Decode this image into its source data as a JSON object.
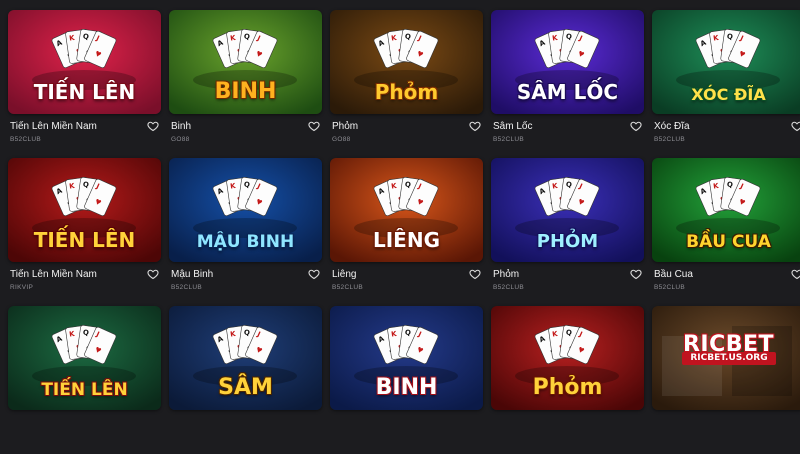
{
  "games": [
    {
      "title_art": "TIẾN LÊN",
      "name": "Tiến Lên Miền Nam",
      "provider": "B52CLUB",
      "bg1": "#e0224a",
      "bg2": "#7a0f2a",
      "title_color": "#ffffff",
      "stroke": "#7a0b18",
      "title_size": 20
    },
    {
      "title_art": "BINH",
      "name": "Binh",
      "provider": "GO88",
      "bg1": "#6aa32c",
      "bg2": "#1e4d12",
      "title_color": "#ffb21f",
      "stroke": "#6b2a00",
      "title_size": 22
    },
    {
      "title_art": "Phỏm",
      "name": "Phỏm",
      "provider": "GO88",
      "bg1": "#7b4a14",
      "bg2": "#2b1a08",
      "title_color": "#ffca2e",
      "stroke": "#7a2a00",
      "title_size": 20
    },
    {
      "title_art": "SÂM LỐC",
      "name": "Sâm Lốc",
      "provider": "B52CLUB",
      "bg1": "#5b2bd6",
      "bg2": "#1f0d66",
      "title_color": "#ffffff",
      "stroke": "#1b0b55",
      "title_size": 20
    },
    {
      "title_art": "XÓC ĐĨA",
      "name": "Xóc Đĩa",
      "provider": "B52CLUB",
      "bg1": "#1e8e58",
      "bg2": "#0a3d24",
      "title_color": "#ffe14a",
      "stroke": "#0b4d24",
      "title_size": 16
    },
    {
      "title_art": "TIẾN LÊN",
      "name": "Tiến Lên Miền Nam",
      "provider": "RIKVIP",
      "bg1": "#b51a1a",
      "bg2": "#4d0606",
      "title_color": "#ffd23a",
      "stroke": "#5a0303",
      "title_size": 20
    },
    {
      "title_art": "MẬU BINH",
      "name": "Mậu Binh",
      "provider": "B52CLUB",
      "bg1": "#1550a8",
      "bg2": "#081f4a",
      "title_color": "#8fe6ff",
      "stroke": "#082455",
      "title_size": 17
    },
    {
      "title_art": "LIÊNG",
      "name": "Liêng",
      "provider": "B52CLUB",
      "bg1": "#d8561a",
      "bg2": "#5a1605",
      "title_color": "#ffffff",
      "stroke": "#6d1a05",
      "title_size": 20
    },
    {
      "title_art": "PHỎM",
      "name": "Phỏm",
      "provider": "B52CLUB",
      "bg1": "#3b2fb8",
      "bg2": "#12105a",
      "title_color": "#9ff0ff",
      "stroke": "#12105a",
      "title_size": 18
    },
    {
      "title_art": "BẦU CUA",
      "name": "Bầu Cua",
      "provider": "B52CLUB",
      "bg1": "#23a23a",
      "bg2": "#08420f",
      "title_color": "#ffd42e",
      "stroke": "#3b1a00",
      "title_size": 17
    },
    {
      "title_art": "TIẾN LÊN",
      "name": "",
      "provider": "",
      "bg1": "#1c6b42",
      "bg2": "#0b2a1a",
      "title_color": "#ffd23a",
      "stroke": "#7a0b0b",
      "title_size": 17
    },
    {
      "title_art": "SÂM",
      "name": "",
      "provider": "",
      "bg1": "#1f3e78",
      "bg2": "#0b1a38",
      "title_color": "#ffd23a",
      "stroke": "#4a2400",
      "title_size": 22
    },
    {
      "title_art": "BINH",
      "name": "",
      "provider": "",
      "bg1": "#243a8a",
      "bg2": "#0b1a48",
      "title_color": "#ffffff",
      "stroke": "#a0101a",
      "title_size": 22
    },
    {
      "title_art": "Phỏm",
      "name": "",
      "provider": "",
      "bg1": "#b82020",
      "bg2": "#4a0606",
      "title_color": "#ffd23a",
      "stroke": "#6a1400",
      "title_size": 22
    },
    {
      "title_art": "",
      "name": "",
      "provider": "",
      "bg1": "#6b4a2a",
      "bg2": "#2a1a0c",
      "title_color": "#ffffff",
      "stroke": "#000000",
      "title_size": 18
    }
  ],
  "watermark": {
    "brand": "RICBET",
    "url": "RICBET.US.ORG",
    "color": "#c0131f"
  }
}
